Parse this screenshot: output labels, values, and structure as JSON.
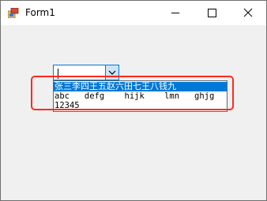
{
  "window": {
    "title": "Form1"
  },
  "combo": {
    "value": ""
  },
  "dropdown": {
    "items": [
      "张三李四王五赵六田七王八钱九",
      "abc   defg    hijk    lmn   ghjg",
      "12345"
    ],
    "selected_index": 0
  },
  "colors": {
    "accent": "#0078d7",
    "highlight_box": "#ff2a1f"
  }
}
